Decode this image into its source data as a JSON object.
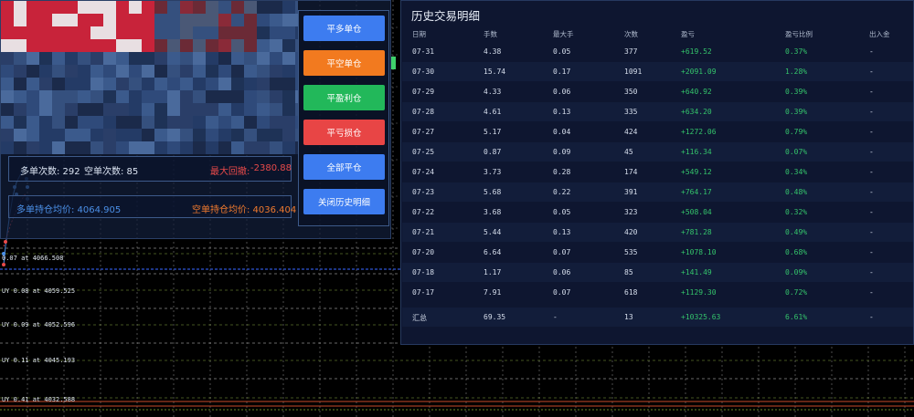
{
  "colors": {
    "win_color": "#34c36b",
    "loss_color": "#e84a4a",
    "avg_long_color": "#4b8fe6",
    "avg_short_color": "#f07a2e"
  },
  "chart": {
    "order_labels": [
      "0.07 at 4066.508",
      "UY 0.08 at 4059.525",
      "UY 0.09 at 4052.596",
      "UY 0.11 at 4045.193",
      "UY 0.41 at 4032.588"
    ]
  },
  "stats": {
    "long_count_label": "多单次数: 292",
    "short_count_label": "空单次数: 85",
    "max_drawdown_label": "最大回撤:",
    "max_drawdown_value": "-2380.88",
    "long_avg_label": "多单持仓均价: 4064.905",
    "short_avg_label": "空单持仓均价: 4036.404"
  },
  "buttons": [
    {
      "label": "平多单仓",
      "color": "#3d7cf0"
    },
    {
      "label": "平空单仓",
      "color": "#f27a1f"
    },
    {
      "label": "平盈利仓",
      "color": "#22b85a"
    },
    {
      "label": "平亏损仓",
      "color": "#e84545"
    },
    {
      "label": "全部平仓",
      "color": "#3d7cf0"
    },
    {
      "label": "关闭历史明细",
      "color": "#3d7cf0"
    }
  ],
  "history": {
    "title": "历史交易明细",
    "columns": [
      "日期",
      "手数",
      "最大手",
      "次数",
      "盈亏",
      "盈亏比例",
      "出入金"
    ],
    "rows": [
      [
        "07-31",
        "4.38",
        "0.05",
        "377",
        "+619.52",
        "0.37%",
        "-"
      ],
      [
        "07-30",
        "15.74",
        "0.17",
        "1091",
        "+2091.09",
        "1.28%",
        "-"
      ],
      [
        "07-29",
        "4.33",
        "0.06",
        "350",
        "+640.92",
        "0.39%",
        "-"
      ],
      [
        "07-28",
        "4.61",
        "0.13",
        "335",
        "+634.20",
        "0.39%",
        "-"
      ],
      [
        "07-27",
        "5.17",
        "0.04",
        "424",
        "+1272.06",
        "0.79%",
        "-"
      ],
      [
        "07-25",
        "0.87",
        "0.09",
        "45",
        "+116.34",
        "0.07%",
        "-"
      ],
      [
        "07-24",
        "3.73",
        "0.28",
        "174",
        "+549.12",
        "0.34%",
        "-"
      ],
      [
        "07-23",
        "5.68",
        "0.22",
        "391",
        "+764.17",
        "0.48%",
        "-"
      ],
      [
        "07-22",
        "3.68",
        "0.05",
        "323",
        "+508.04",
        "0.32%",
        "-"
      ],
      [
        "07-21",
        "5.44",
        "0.13",
        "420",
        "+781.28",
        "0.49%",
        "-"
      ],
      [
        "07-20",
        "6.64",
        "0.07",
        "535",
        "+1078.10",
        "0.68%",
        "-"
      ],
      [
        "07-18",
        "1.17",
        "0.06",
        "85",
        "+141.49",
        "0.09%",
        "-"
      ],
      [
        "07-17",
        "7.91",
        "0.07",
        "618",
        "+1129.30",
        "0.72%",
        "-"
      ]
    ],
    "total": [
      "汇总",
      "69.35",
      "-",
      "13",
      "+10325.63",
      "6.61%",
      "-"
    ]
  }
}
